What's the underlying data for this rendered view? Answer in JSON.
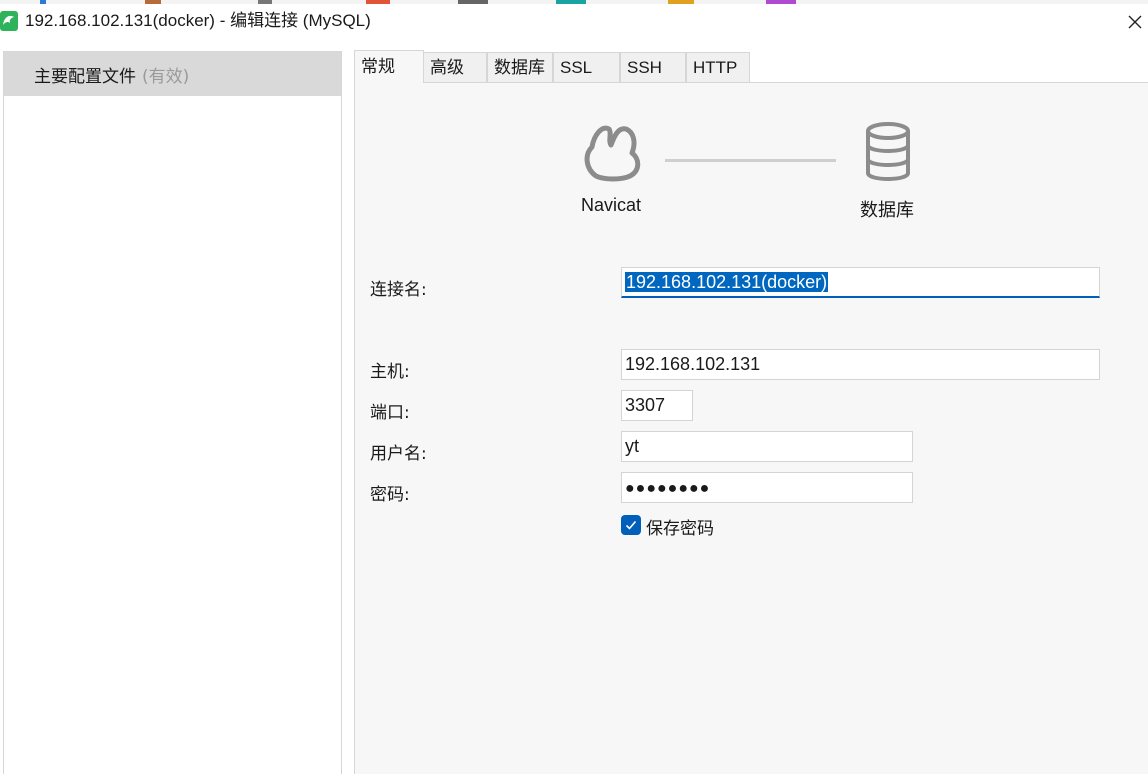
{
  "window": {
    "title": "192.168.102.131(docker) - 编辑连接 (MySQL)"
  },
  "sidebar": {
    "items": [
      {
        "label": "主要配置文件",
        "status": "(有效)"
      }
    ]
  },
  "tabs": [
    {
      "label": "常规",
      "active": true
    },
    {
      "label": "高级",
      "active": false
    },
    {
      "label": "数据库",
      "active": false
    },
    {
      "label": "SSL",
      "active": false
    },
    {
      "label": "SSH",
      "active": false
    },
    {
      "label": "HTTP",
      "active": false
    }
  ],
  "diagram": {
    "left_label": "Navicat",
    "right_label": "数据库",
    "left_icon": "navicat-logo-icon",
    "right_icon": "database-icon"
  },
  "form": {
    "connection_name": {
      "label": "连接名:",
      "value": "192.168.102.131(docker)"
    },
    "host": {
      "label": "主机:",
      "value": "192.168.102.131"
    },
    "port": {
      "label": "端口:",
      "value": "3307"
    },
    "username": {
      "label": "用户名:",
      "value": "yt"
    },
    "password": {
      "label": "密码:",
      "value": "●●●●●●●●"
    },
    "save_password": {
      "label": "保存密码",
      "checked": true
    }
  },
  "colors": {
    "accent": "#005fb8",
    "selection": "#0067c0",
    "app_icon": "#2fb35a"
  }
}
